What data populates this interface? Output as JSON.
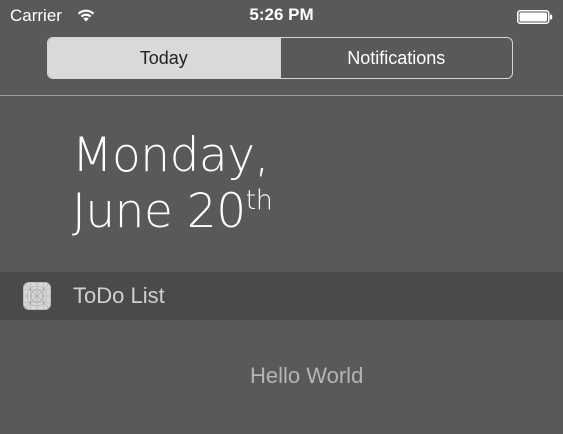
{
  "status_bar": {
    "carrier": "Carrier",
    "time": "5:26 PM",
    "wifi_icon": "wifi-icon",
    "battery_icon": "battery-full-icon"
  },
  "segmented_control": {
    "tabs": [
      {
        "label": "Today",
        "selected": true
      },
      {
        "label": "Notifications",
        "selected": false
      }
    ]
  },
  "date": {
    "weekday": "Monday,",
    "month_day": "June 20",
    "ordinal": "th"
  },
  "widget": {
    "icon": "app-icon",
    "title": "ToDo List",
    "content": "Hello World"
  },
  "colors": {
    "background": "#595959",
    "widget_header": "#4a4a4a",
    "segment_selected": "#d9d9d9",
    "text_primary": "#ffffff",
    "text_secondary": "#b5b5b5"
  }
}
